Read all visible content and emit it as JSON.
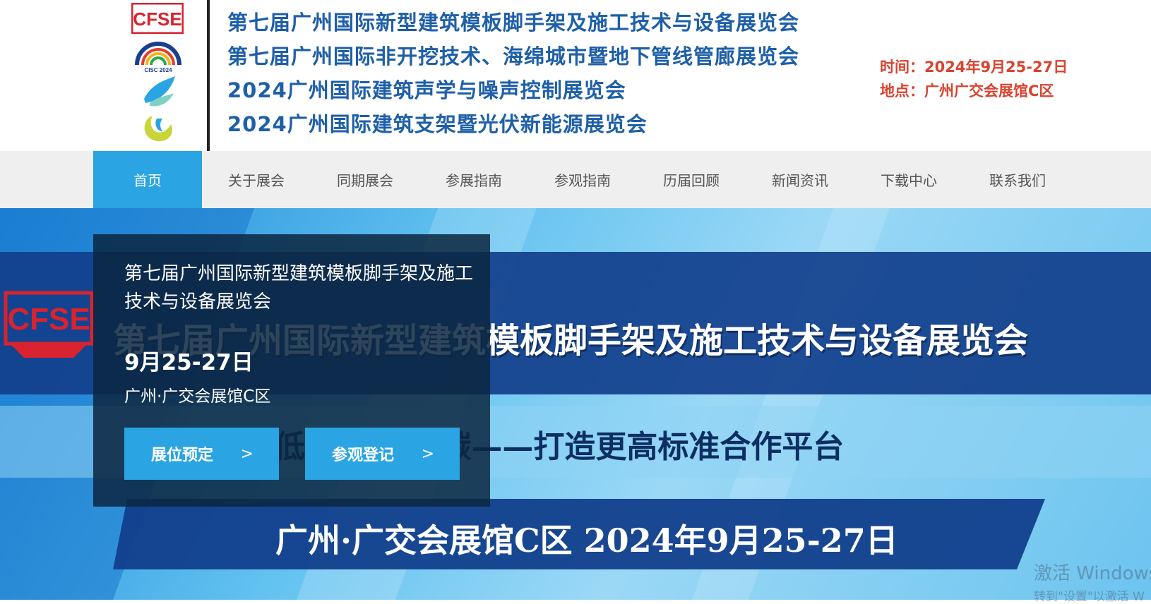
{
  "header": {
    "logos": {
      "cfse_logo_text": "CFSE",
      "cisc_logo_text": "CISC 2024"
    },
    "titles": [
      "第七届广州国际新型建筑模板脚手架及施工技术与设备展览会",
      "第七届广州国际非开挖技术、海绵城市暨地下管线管廊展览会",
      "2024广州国际建筑声学与噪声控制展览会",
      "2024广州国际建筑支架暨光伏新能源展览会"
    ],
    "time": "时间：2024年9月25-27日",
    "location": "地点：广州广交会展馆C区"
  },
  "nav": {
    "items": [
      {
        "label": "首页",
        "active": true
      },
      {
        "label": "关于展会"
      },
      {
        "label": "同期展会"
      },
      {
        "label": "参展指南"
      },
      {
        "label": "参观指南"
      },
      {
        "label": "历届回顾"
      },
      {
        "label": "新闻资讯"
      },
      {
        "label": "下载中心"
      },
      {
        "label": "联系我们"
      }
    ]
  },
  "banner": {
    "image_title": "第七届广州国际新型建筑模板脚手架及施工技术与设备展览会",
    "image_slogan": "绿色低碳 助力双碳——打造更高标准合作平台",
    "image_place_date": "广州·广交会展馆C区  2024年9月25-27日",
    "card": {
      "title": "第七届广州国际新型建筑模板脚手架及施工技术与设备展览会",
      "date": "9月25-27日",
      "place": "广州·广交会展馆C区",
      "booking_button": "展位预定",
      "visit_button": "参观登记",
      "arrow": ">"
    }
  },
  "watermark": {
    "line1": "激活 Windows",
    "line2": "转到\"设置\"以激活 W"
  },
  "colors": {
    "title_blue": "#1e5fa8",
    "meta_red": "#d9432f",
    "accent_blue": "#2aa4e2",
    "card_bg": "#0c2640"
  }
}
